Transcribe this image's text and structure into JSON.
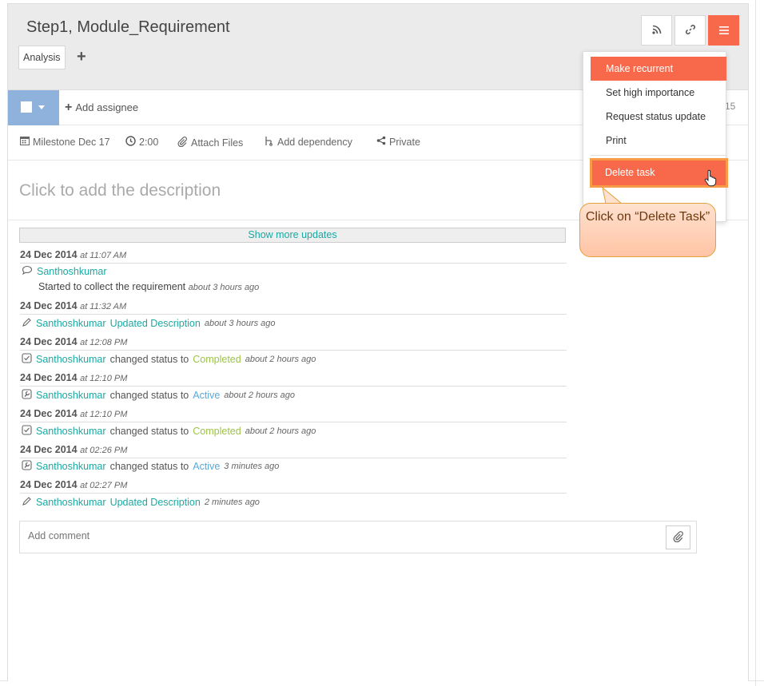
{
  "task": {
    "title": "Step1, Module_Requirement",
    "tag": "Analysis"
  },
  "header_buttons": [
    {
      "name": "rss-button",
      "icon": "rss-icon"
    },
    {
      "name": "link-button",
      "icon": "link-icon"
    },
    {
      "name": "menu-button",
      "icon": "hamburger-icon"
    }
  ],
  "assignee": {
    "add_label": "Add assignee",
    "right_number": "15"
  },
  "meta": {
    "milestone": "Milestone Dec 17",
    "time": "2:00",
    "attach": "Attach Files",
    "dependency": "Add dependency",
    "privacy": "Private"
  },
  "description_placeholder": "Click to add the description",
  "show_more": "Show more updates",
  "updates": [
    {
      "date": "24 Dec 2014",
      "at": "at 11:07 AM",
      "user": "Santhoshkumar",
      "action": "",
      "status": "",
      "ago": "",
      "text": "Started to collect the requirement",
      "text_ago": "about 3 hours ago",
      "icon": "comment-icon"
    },
    {
      "date": "24 Dec 2014",
      "at": "at 11:32 AM",
      "user": "Santhoshkumar",
      "action": "Updated Description",
      "status": "",
      "ago": "about 3 hours ago",
      "icon": "pencil-icon"
    },
    {
      "date": "24 Dec 2014",
      "at": "at 12:08 PM",
      "user": "Santhoshkumar",
      "action": "changed status to",
      "status": "Completed",
      "ago": "about 2 hours ago",
      "icon": "checkbox-icon"
    },
    {
      "date": "24 Dec 2014",
      "at": "at 12:10 PM",
      "user": "Santhoshkumar",
      "action": "changed status to",
      "status": "Active",
      "ago": "about 2 hours ago",
      "icon": "wrench-icon"
    },
    {
      "date": "24 Dec 2014",
      "at": "at 12:10 PM",
      "user": "Santhoshkumar",
      "action": "changed status to",
      "status": "Completed",
      "ago": "about 2 hours ago",
      "icon": "checkbox-icon"
    },
    {
      "date": "24 Dec 2014",
      "at": "at 02:26 PM",
      "user": "Santhoshkumar",
      "action": "changed status to",
      "status": "Active",
      "ago": "3 minutes ago",
      "icon": "wrench-icon"
    },
    {
      "date": "24 Dec 2014",
      "at": "at 02:27 PM",
      "user": "Santhoshkumar",
      "action": "Updated Description",
      "status": "",
      "ago": "2 minutes ago",
      "icon": "pencil-icon"
    }
  ],
  "comment": {
    "placeholder": "Add comment"
  },
  "menu": {
    "items": [
      "Make recurrent",
      "Set high importance",
      "Request status update",
      "Print"
    ],
    "delete": "Delete task"
  },
  "callout": "Click on “Delete Task”",
  "colors": {
    "accent": "#f7694a",
    "teal": "#1ba8a1",
    "completed": "#9cc24a",
    "active": "#5aa8d8",
    "callout_border": "#e2a13e"
  }
}
